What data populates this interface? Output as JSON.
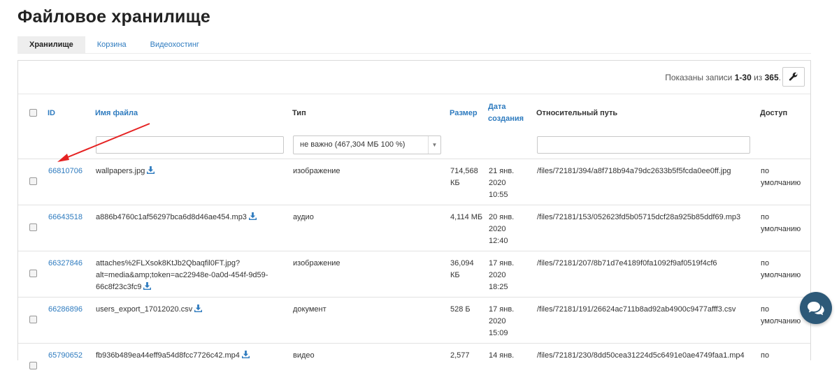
{
  "page": {
    "title": "Файловое хранилище"
  },
  "tabs": [
    {
      "label": "Хранилище",
      "active": true
    },
    {
      "label": "Корзина",
      "active": false
    },
    {
      "label": "Видеохостинг",
      "active": false
    }
  ],
  "records": {
    "prefix": "Показаны записи ",
    "range": "1-30",
    "middle": " из ",
    "total": "365",
    "suffix": "."
  },
  "table": {
    "columns": {
      "id": "ID",
      "name": "Имя файла",
      "type": "Тип",
      "size": "Размер",
      "date_line1": "Дата",
      "date_line2": "создания",
      "path": "Относительный путь",
      "access": "Доступ"
    },
    "filters": {
      "type_value": "не важно (467,304 МБ 100 %)"
    },
    "rows": [
      {
        "id": "66810706",
        "name": "wallpapers.jpg",
        "type": "изображение",
        "size1": "714,568",
        "size2": "КБ",
        "date1": "21 янв.",
        "date2": "2020",
        "date3": "10:55",
        "path": "/files/72181/394/a8f718b94a79dc2633b5f5fcda0ee0ff.jpg",
        "access1": "по",
        "access2": "умолчанию"
      },
      {
        "id": "66643518",
        "name": "a886b4760c1af56297bca6d8d46ae454.mp3",
        "type": "аудио",
        "size1": "4,114 МБ",
        "size2": "",
        "date1": "20 янв.",
        "date2": "2020",
        "date3": "12:40",
        "path": "/files/72181/153/052623fd5b05715dcf28a925b85ddf69.mp3",
        "access1": "по",
        "access2": "умолчанию"
      },
      {
        "id": "66327846",
        "name_line1": "attaches%2FLXsok8KtJb2Qbaqfil0FT.jpg?",
        "name_line2": "alt=media&amp;token=ac22948e-0a0d-454f-9d59-",
        "name_line3": "66c8f23c3fc9",
        "type": "изображение",
        "size1": "36,094",
        "size2": "КБ",
        "date1": "17 янв.",
        "date2": "2020",
        "date3": "18:25",
        "path": "/files/72181/207/8b71d7e4189f0fa1092f9af0519f4cf6",
        "access1": "по",
        "access2": "умолчанию"
      },
      {
        "id": "66286896",
        "name": "users_export_17012020.csv",
        "type": "документ",
        "size1": "528 Б",
        "size2": "",
        "date1": "17 янв.",
        "date2": "2020",
        "date3": "15:09",
        "path": "/files/72181/191/26624ac711b8ad92ab4900c9477afff3.csv",
        "access1": "по",
        "access2": "умолчанию"
      },
      {
        "id": "65790652",
        "name": "fb936b489ea44eff9a54d8fcc7726c42.mp4",
        "type": "видео",
        "size1": "2,577",
        "size2": "",
        "date1": "14 янв.",
        "date2": "",
        "date3": "",
        "path": "/files/72181/230/8dd50cea31224d5c6491e0ae4749faa1.mp4",
        "access1": "по",
        "access2": ""
      }
    ]
  },
  "icons": {
    "settings": "wrench-icon",
    "download": "download-icon",
    "chat": "chat-icon",
    "annotation": "red-arrow"
  },
  "colors": {
    "link": "#2e7bbf",
    "chat": "#2d5978",
    "arrow": "#e52222"
  }
}
